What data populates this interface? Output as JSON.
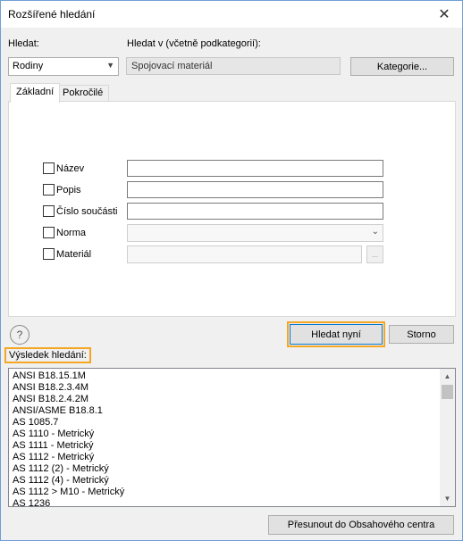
{
  "window": {
    "title": "Rozšířené hledání",
    "close_glyph": "✕"
  },
  "search": {
    "hledat_label": "Hledat:",
    "hledat_value": "Rodiny",
    "hledat_v_label": "Hledat v (včetně podkategorií):",
    "hledat_v_value": "Spojovací materiál",
    "category_button": "Kategorie..."
  },
  "tabs": [
    {
      "label": "Základní",
      "active": true
    },
    {
      "label": "Pokročilé",
      "active": false
    }
  ],
  "criteria": [
    {
      "label": "Název",
      "value": ""
    },
    {
      "label": "Popis",
      "value": ""
    },
    {
      "label": "Číslo součásti",
      "value": ""
    },
    {
      "label": "Norma",
      "value": ""
    },
    {
      "label": "Materiál",
      "value": ""
    }
  ],
  "material_browse": "...",
  "help_glyph": "?",
  "buttons": {
    "search_now": "Hledat nyní",
    "cancel": "Storno",
    "move_to": "Přesunout do Obsahového centra"
  },
  "results_label": "Výsledek hledání:",
  "results": [
    "ANSI B18.15.1M",
    "ANSI B18.2.3.4M",
    "ANSI B18.2.4.2M",
    "ANSI/ASME B18.8.1",
    "AS 1085.7",
    "AS 1110 - Metrický",
    "AS 1111 - Metrický",
    "AS 1112 - Metrický",
    "AS 1112 (2) - Metrický",
    "AS 1112 (4) - Metrický",
    "AS 1112 > M10 - Metrický",
    "AS 1236"
  ],
  "colors": {
    "highlight": "#f5a623",
    "title_border": "#6f9fd6"
  }
}
